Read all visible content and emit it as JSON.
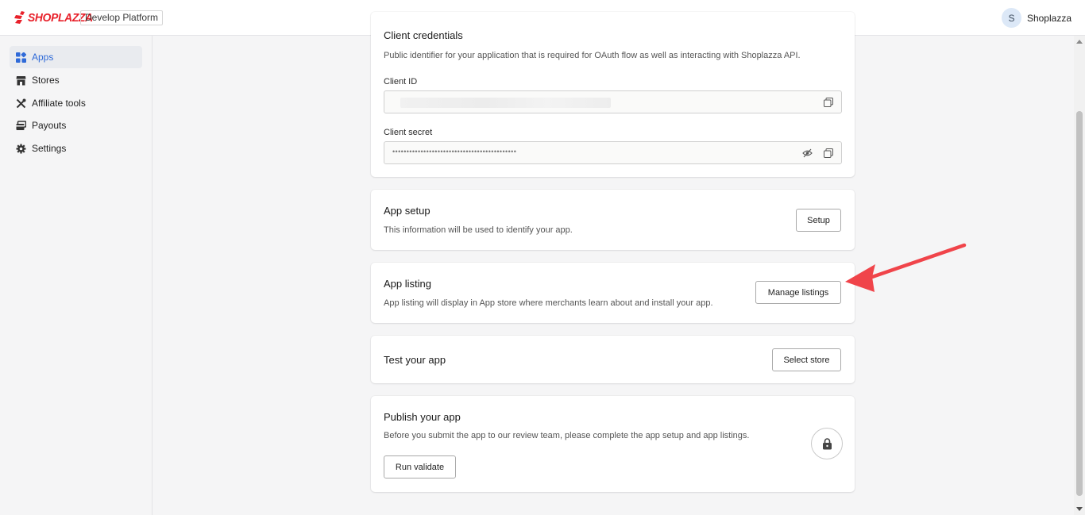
{
  "header": {
    "logo_text": "SHOPLAZZA",
    "platform_tag": "Develop Platform",
    "user_initial": "S",
    "user_name": "Shoplazza"
  },
  "sidebar": {
    "items": [
      {
        "label": "Apps",
        "icon": "apps-grid-icon",
        "active": true
      },
      {
        "label": "Stores",
        "icon": "store-icon",
        "active": false
      },
      {
        "label": "Affiliate tools",
        "icon": "tools-icon",
        "active": false
      },
      {
        "label": "Payouts",
        "icon": "payouts-icon",
        "active": false
      },
      {
        "label": "Settings",
        "icon": "gear-icon",
        "active": false
      }
    ]
  },
  "credentials": {
    "title": "Client credentials",
    "description": "Public identifier for your application that is required for OAuth flow as well as interacting with Shoplazza API.",
    "client_id_label": "Client ID",
    "client_secret_label": "Client secret",
    "client_secret_masked": "••••••••••••••••••••••••••••••••••••••••••••"
  },
  "app_setup": {
    "title": "App setup",
    "description": "This information will be used to identify your app.",
    "button": "Setup"
  },
  "app_listing": {
    "title": "App listing",
    "description": "App listing will display in App store where merchants learn about and install your app.",
    "button": "Manage listings"
  },
  "test_app": {
    "title": "Test your app",
    "button": "Select store"
  },
  "publish_app": {
    "title": "Publish your app",
    "description": "Before you submit the app to our review team, please complete the app setup and app listings.",
    "button": "Run validate"
  },
  "colors": {
    "brand": "#e8202a",
    "accent": "#2f6ad8",
    "annotation_arrow": "#f0444a"
  }
}
